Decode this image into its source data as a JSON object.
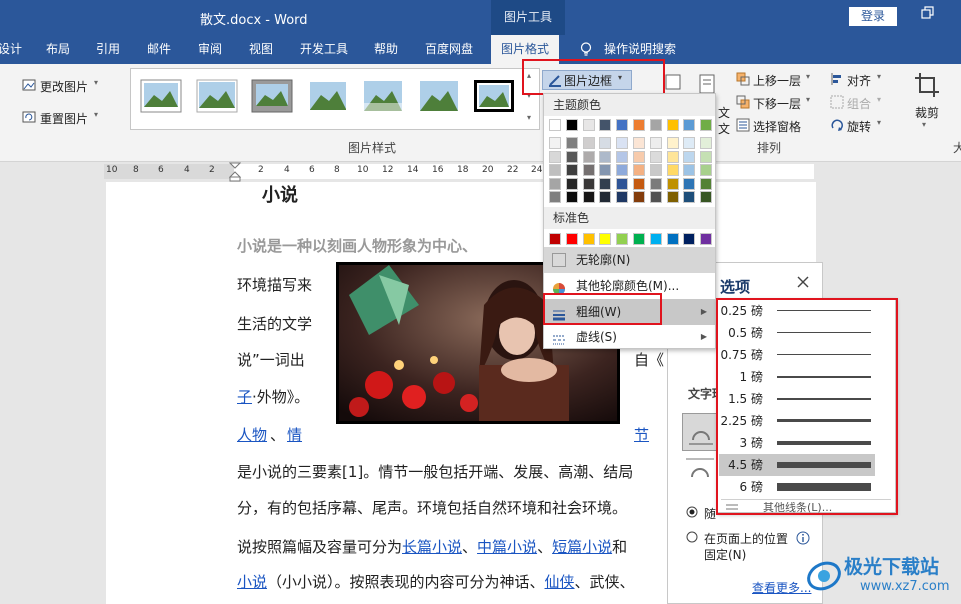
{
  "window": {
    "doc_title": "散文.docx  -  Word",
    "context_tab_group": "图片工具",
    "login_button": "登录",
    "restore_icon": "restore-icon"
  },
  "tabs": {
    "design_partial": "设计",
    "layout": "布局",
    "references": "引用",
    "mailings": "邮件",
    "review": "审阅",
    "view": "视图",
    "developer": "开发工具",
    "help": "帮助",
    "baidu": "百度网盘",
    "picture_format": "图片格式",
    "tell_me": "操作说明搜索"
  },
  "ribbon": {
    "change_picture": "更改图片",
    "reset_picture": "重置图片",
    "picture_styles_group": "图片样式",
    "picture_border": "图片边框",
    "text_partial": "文",
    "bring_forward": "上移一层",
    "send_backward": "下移一层",
    "selection_pane": "选择窗格",
    "align": "对齐",
    "group": "组合",
    "rotate": "旋转",
    "arrange_group": "排列",
    "crop": "裁剪",
    "size_partial": "大"
  },
  "ruler": {
    "numbers": [
      "10",
      "8",
      "6",
      "4",
      "2",
      "2",
      "4",
      "6",
      "8",
      "10",
      "12",
      "14",
      "16",
      "18",
      "20",
      "22",
      "24",
      "26"
    ]
  },
  "document": {
    "heading_partial": "小说",
    "line1": "小说是一种以刻画人物形象为中心、",
    "line2": "环境描写来",
    "line3": "生活的文学",
    "line4": "说”一词出",
    "line4_right": "自《",
    "line5_link": "子",
    "line5_rest": "·外物》。",
    "line6_link1": "人物",
    "line6_sep": "、",
    "line6_link2": "情",
    "line6_right": "节",
    "line7": "是小说的三要素[1]。情节一般包括开端、发展、高潮、结局",
    "line8": "分，有的包括序幕、尾声。环境包括自然环境和社会环境。",
    "line9_pre": "说按照篇幅及容量可分为",
    "line9_link1": "长篇小说",
    "line9_link2": "中篇小说",
    "line9_link3": "短篇小说",
    "line9_post": "和",
    "line10_link1": "小说",
    "line10_mid": "（小小说）。按照表现的内容可分为神话、",
    "line10_link2": "仙侠",
    "line10_post": "、武侠、"
  },
  "pane": {
    "title_partial": "选项",
    "close_icon": "close-icon",
    "section_partial": "文字环",
    "radio1_partial": "随",
    "radio2_line1": "在页面上的位置",
    "radio2_line2": "固定(N)",
    "see_more": "查看更多..."
  },
  "border_menu": {
    "theme_colors_label": "主题颜色",
    "standard_colors_label": "标准色",
    "no_outline": "无轮廓(N)",
    "more_colors": "其他轮廓颜色(M)...",
    "weight": "粗细(W)",
    "dashes": "虚线(S)",
    "theme_top_row": [
      "#ffffff",
      "#000000",
      "#e7e6e6",
      "#44546a",
      "#4472c4",
      "#ed7d31",
      "#a5a5a5",
      "#ffc000",
      "#5b9bd5",
      "#70ad47"
    ],
    "theme_shades": [
      [
        "#f2f2f2",
        "#7f7f7f",
        "#d0cece",
        "#d6dce4",
        "#d9e2f3",
        "#fbe5d5",
        "#ededed",
        "#fff2cc",
        "#deebf6",
        "#e2efd9"
      ],
      [
        "#d8d8d8",
        "#595959",
        "#aeabab",
        "#adb9ca",
        "#b4c6e7",
        "#f7cbac",
        "#dbdbdb",
        "#fee599",
        "#bdd7ee",
        "#c5e0b3"
      ],
      [
        "#bfbfbf",
        "#3f3f3f",
        "#757070",
        "#8496b0",
        "#8eaadb",
        "#f4b183",
        "#c9c9c9",
        "#ffd965",
        "#9cc3e5",
        "#a8d08d"
      ],
      [
        "#a5a5a5",
        "#262626",
        "#3a3838",
        "#323f4f",
        "#2f5496",
        "#c55a11",
        "#7b7b7b",
        "#bf9000",
        "#2e75b5",
        "#538135"
      ],
      [
        "#7f7f7f",
        "#0c0c0c",
        "#171616",
        "#222a35",
        "#1f3864",
        "#833c0b",
        "#525252",
        "#7f6000",
        "#1e4e79",
        "#375623"
      ]
    ],
    "standard": [
      "#c00000",
      "#ff0000",
      "#ffc000",
      "#ffff00",
      "#92d050",
      "#00b050",
      "#00b0f0",
      "#0070c0",
      "#002060",
      "#7030a0"
    ]
  },
  "weight_menu": {
    "options": [
      "0.25 磅",
      "0.5 磅",
      "0.75 磅",
      "1 磅",
      "1.5 磅",
      "2.25 磅",
      "3 磅",
      "4.5 磅",
      "6 磅"
    ],
    "selected": "4.5 磅",
    "more_lines": "其他线条(L)..."
  },
  "watermark": {
    "name": "极光下载站",
    "url": "www.xz7.com"
  }
}
